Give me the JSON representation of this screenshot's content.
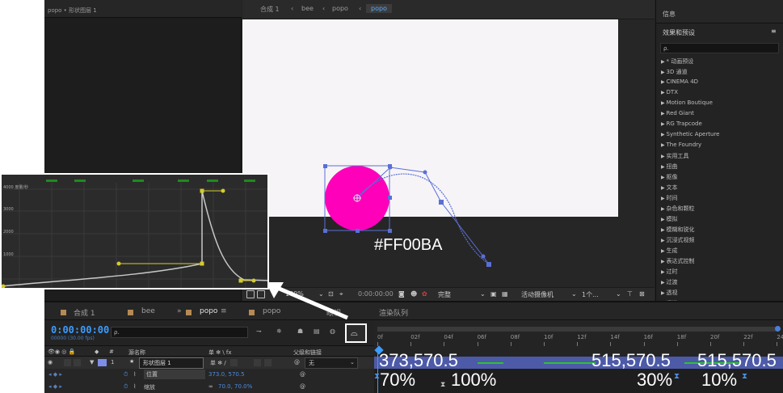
{
  "left_panel": {
    "title": "popo • 形状图层 1"
  },
  "viewer": {
    "breadcrumbs": [
      "合成 1",
      "bee",
      "popo",
      "popo"
    ],
    "color_annotation": "#FF00BA",
    "toolbar": {
      "zoom": "100%",
      "timecode": "0:00:00:00",
      "resolution": "完整",
      "camera": "活动摄像机",
      "views": "1个..."
    }
  },
  "effects_panel": {
    "header": "信息",
    "title": "效果和预设",
    "search_placeholder": "ρ.",
    "items": [
      "* 动画预设",
      "3D 通道",
      "CINEMA 4D",
      "DTX",
      "Motion Boutique",
      "Red Giant",
      "RG Trapcode",
      "Synthetic Aperture",
      "The Foundry",
      "实用工具",
      "扭曲",
      "抠像",
      "文本",
      "时间",
      "杂色和颗粒",
      "模拟",
      "模糊和锐化",
      "沉浸式视频",
      "生成",
      "表达式控制",
      "过时",
      "过渡",
      "透视",
      "通道"
    ]
  },
  "timeline": {
    "tabs": [
      "合成 1",
      "bee",
      "popo",
      "popo",
      "眼视",
      "渲染队列"
    ],
    "timecode": "0:00:00:00",
    "timecode_sub": "00000 (30.00 fps)",
    "search_placeholder": "ρ.",
    "header_cols": {
      "num": "#",
      "name": "源名称",
      "switches": "单 ✻ \\ fx",
      "parent": "父级和链接"
    },
    "layer": {
      "num": "1",
      "name": "形状图层 1",
      "parent_value": "无"
    },
    "props": [
      {
        "name": "位置",
        "value": "373.0, 570.5"
      },
      {
        "name": "缩放",
        "value": "70.0, 70.0%"
      }
    ],
    "ruler_labels": [
      "0f",
      "02f",
      "04f",
      "06f",
      "08f",
      "10f",
      "12f",
      "14f",
      "16f",
      "18f",
      "20f",
      "22f",
      "24"
    ],
    "position_keyframes": [
      "373,570.5",
      "515,570.5",
      "515,570.5"
    ],
    "scale_keyframes": [
      "70%",
      "100%",
      "30%",
      "10%"
    ]
  },
  "graph_editor": {
    "y_labels": [
      "4000 度量/秒",
      "3000",
      "2000",
      "1000"
    ]
  },
  "colors": {
    "accent": "#3c9cff",
    "magenta": "#ff00ba",
    "handle": "#5a6fd6",
    "graph_line": "#c8c8c8",
    "graph_handle": "#d4cc2a"
  }
}
